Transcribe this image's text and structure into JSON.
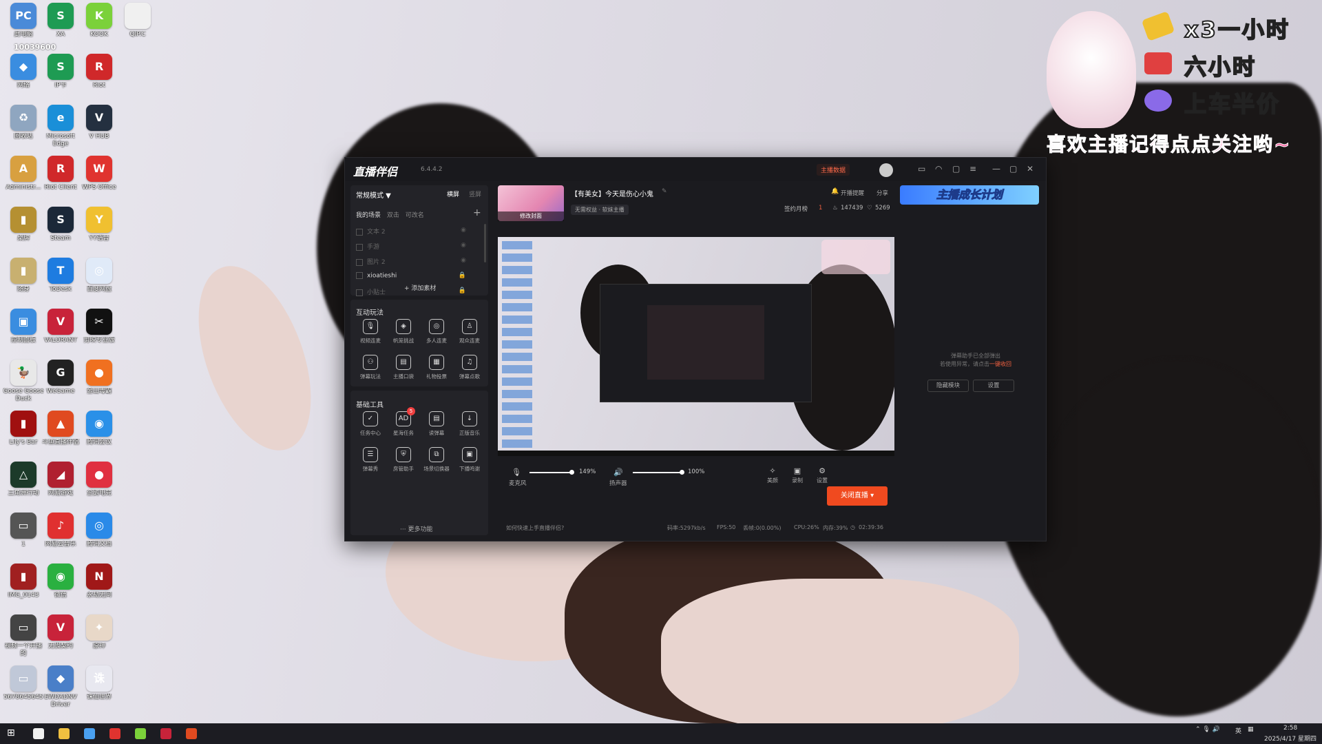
{
  "desktop": {
    "icons": [
      {
        "label": "此电脑",
        "color": "#4a8ad8",
        "g": "PC"
      },
      {
        "label": "XA",
        "color": "#1e9b53",
        "g": "S"
      },
      {
        "label": "KOOK",
        "color": "#7bd13a",
        "g": "K"
      },
      {
        "label": "QIP.C",
        "color": "#f0f0f0",
        "g": ""
      },
      {
        "label": "网络",
        "color": "#3a8de0",
        "g": "◆"
      },
      {
        "label": "IP卡",
        "color": "#1e9b53",
        "g": "S"
      },
      {
        "label": "Riot",
        "color": "#d0282a",
        "g": "R"
      },
      {
        "label": "回收站",
        "color": "#8fa6c0",
        "g": "♻"
      },
      {
        "label": "Microsoft Edge",
        "color": "#1a8fd8",
        "g": "e"
      },
      {
        "label": "V HUB",
        "color": "#243040",
        "g": "V"
      },
      {
        "label": "Administr...",
        "color": "#d8a040",
        "g": "A"
      },
      {
        "label": "Riot Client",
        "color": "#d0282a",
        "g": "R"
      },
      {
        "label": "WPS Office",
        "color": "#e0332f",
        "g": "W"
      },
      {
        "label": "桌牌",
        "color": "#b59032",
        "g": "▮"
      },
      {
        "label": "Steam",
        "color": "#1b2838",
        "g": "S"
      },
      {
        "label": "YY语音",
        "color": "#f0c030",
        "g": "Y"
      },
      {
        "label": "随身",
        "color": "#c8b070",
        "g": "▮"
      },
      {
        "label": "ToDesk",
        "color": "#1e7ce0",
        "g": "T"
      },
      {
        "label": "百度网盘",
        "color": "#e0eaf8",
        "g": "◎"
      },
      {
        "label": "控制面板",
        "color": "#3a8de0",
        "g": "▣"
      },
      {
        "label": "VALORANT",
        "color": "#c8233a",
        "g": "V"
      },
      {
        "label": "剪映专业版",
        "color": "#111",
        "g": "✂"
      },
      {
        "label": "Goose Goose Duck",
        "color": "#e8e8e8",
        "g": "🦆"
      },
      {
        "label": "WeGame",
        "color": "#222",
        "g": "G"
      },
      {
        "label": "金山毒霸",
        "color": "#f07020",
        "g": "●"
      },
      {
        "label": "Lily's Bar",
        "color": "#a01010",
        "g": "▮"
      },
      {
        "label": "斗鱼直播伴侣",
        "color": "#e04a20",
        "g": "▲"
      },
      {
        "label": "腾讯会议",
        "color": "#2a90e8",
        "g": "◉"
      },
      {
        "label": "三角洲行动",
        "color": "#1c3a2a",
        "g": "△"
      },
      {
        "label": "网易游戏",
        "color": "#b02030",
        "g": "◢"
      },
      {
        "label": "企鹅电竞",
        "color": "#e03040",
        "g": "●"
      },
      {
        "label": "1",
        "color": "#555",
        "g": "▭"
      },
      {
        "label": "网易云音乐",
        "color": "#e03030",
        "g": "♪"
      },
      {
        "label": "腾讯文档",
        "color": "#2a8ae8",
        "g": "◎"
      },
      {
        "label": "IMG_0143",
        "color": "#a02020",
        "g": "▮"
      },
      {
        "label": "微信",
        "color": "#2ab040",
        "g": "◉"
      },
      {
        "label": "永劫无间",
        "color": "#a01818",
        "g": "N"
      },
      {
        "label": "视频一个开播的",
        "color": "#444",
        "g": "▭"
      },
      {
        "label": "无畏契约",
        "color": "#c8233a",
        "g": "V"
      },
      {
        "label": "原神",
        "color": "#e8d8c8",
        "g": "✦"
      },
      {
        "label": "5678645645",
        "color": "#c0c8d8",
        "g": "▭"
      },
      {
        "label": "EWDADNV Driver",
        "color": "#4a7fc8",
        "g": "◆"
      },
      {
        "label": "诛仙世界",
        "color": "#e8e8f0",
        "g": "诛"
      }
    ]
  },
  "overlay": {
    "line1": "x3一小时",
    "line2": "六小时",
    "line3": "上车半价",
    "slogan": "喜欢主播记得点点关注哟~",
    "watermark": "10039600"
  },
  "app": {
    "title": "直播伴侣",
    "version": "6.4.4.2",
    "anchor_data": "主播数据",
    "mode": "常规模式 ▼",
    "layout_landscape": "横屏",
    "layout_portrait": "竖屏",
    "scene_tabs": [
      "我的场景",
      "双击",
      "可改名"
    ],
    "add_scene": "+",
    "scenes": [
      {
        "name": "文本 2",
        "lock": false
      },
      {
        "name": "手游",
        "lock": false
      },
      {
        "name": "图片 2",
        "lock": false
      },
      {
        "name": "xioatieshi",
        "lock": true,
        "active": true
      },
      {
        "name": "小贴士",
        "lock": true
      }
    ],
    "add_material": "+ 添加素材",
    "interactive_title": "互动玩法",
    "interactive": [
      {
        "label": "视频连麦",
        "g": "🎙"
      },
      {
        "label": "帆笼挑战",
        "g": "◈"
      },
      {
        "label": "多人连麦",
        "g": "◎"
      },
      {
        "label": "观众连麦",
        "g": "♙"
      },
      {
        "label": "弹幕玩法",
        "g": "⚇"
      },
      {
        "label": "主播口袋",
        "g": "▤"
      },
      {
        "label": "礼物投票",
        "g": "▦"
      },
      {
        "label": "弹幕点歌",
        "g": "♫"
      }
    ],
    "basic_title": "基础工具",
    "basic": [
      {
        "label": "任务中心",
        "g": "✓"
      },
      {
        "label": "星海任务",
        "g": "AD",
        "badge": "5"
      },
      {
        "label": "读弹幕",
        "g": "▤"
      },
      {
        "label": "正版音乐",
        "g": "↓"
      },
      {
        "label": "弹幕秀",
        "g": "☰"
      },
      {
        "label": "房管助手",
        "g": "⛨"
      },
      {
        "label": "场景切换器",
        "g": "⧉"
      },
      {
        "label": "下播鸣谢",
        "g": "▣"
      }
    ],
    "more_features": "··· 更多功能",
    "cover_edit": "修改封面",
    "stream_title": "【有美女】今天是伤心小鬼",
    "tag": "无需权益 · 软妹主播",
    "remind": "开播提醒",
    "share": "分享",
    "monthly": "签约月榜",
    "monthly_rank": "1",
    "likes": "147439",
    "fans": "5269",
    "mic_label": "麦克风",
    "mic_pct": "149%",
    "speaker_label": "扬声器",
    "speaker_pct": "100%",
    "beauty": "美颜",
    "record": "录制",
    "settings": "设置",
    "close_live": "关闭直播 ▾",
    "help": "如何快速上手直播伴侣?",
    "status": {
      "bitrate": "码率:5297kb/s",
      "fps": "FPS:50",
      "drop": "丢帧:0(0.00%)",
      "cpu": "CPU:26%",
      "mem": "内存:39%",
      "time": "02:39:36"
    },
    "growth": "主播成长计划",
    "danmu_msg1": "弹幕助手已全部弹出",
    "danmu_msg2": "若使用异常，请点击",
    "danmu_link": "一键收回",
    "hide_block": "隐藏模块",
    "r_settings": "设置"
  },
  "taskbar": {
    "time": "2:58",
    "date": "2025/4/17 星期四",
    "lang": "英",
    "apps": [
      "#f0f0f0",
      "#f0c040",
      "#4aa0f0",
      "#e0332f",
      "#7bd13a",
      "#c8233a",
      "#e04a20"
    ]
  }
}
